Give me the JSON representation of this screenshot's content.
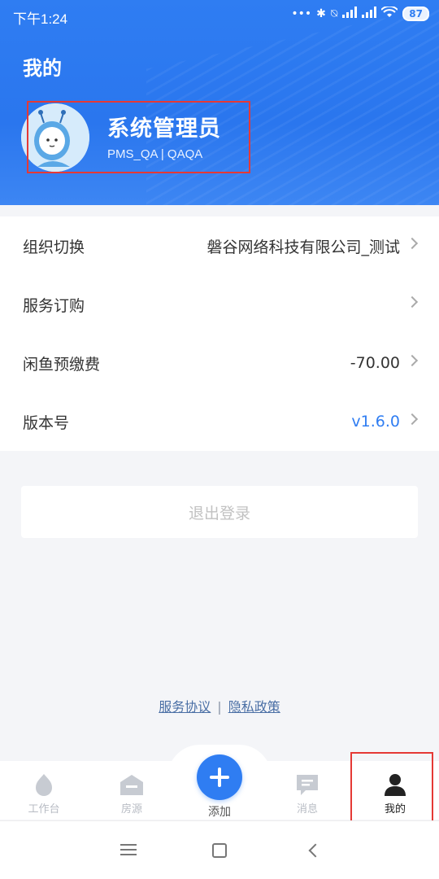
{
  "status_bar": {
    "time": "下午1:24",
    "battery": "87"
  },
  "header": {
    "title": "我的",
    "user_name": "系统管理员",
    "user_sub": "PMS_QA | QAQA"
  },
  "settings": [
    {
      "label": "组织切换",
      "value": "磐谷网络科技有限公司_测试"
    },
    {
      "label": "服务订购",
      "value": ""
    },
    {
      "label": "闲鱼预缴费",
      "value": "-70.00"
    },
    {
      "label": "版本号",
      "value": "v1.6.0"
    }
  ],
  "logout_label": "退出登录",
  "links": {
    "service": "服务协议",
    "separator": "|",
    "privacy": "隐私政策"
  },
  "tabs": [
    {
      "label": "工作台",
      "icon": "home-icon"
    },
    {
      "label": "房源",
      "icon": "house-icon"
    },
    {
      "label": "添加",
      "icon": "plus-icon"
    },
    {
      "label": "消息",
      "icon": "message-icon"
    },
    {
      "label": "我的",
      "icon": "user-icon",
      "active": true
    }
  ],
  "colors": {
    "brand": "#2f7df2",
    "highlight": "#e53935"
  }
}
